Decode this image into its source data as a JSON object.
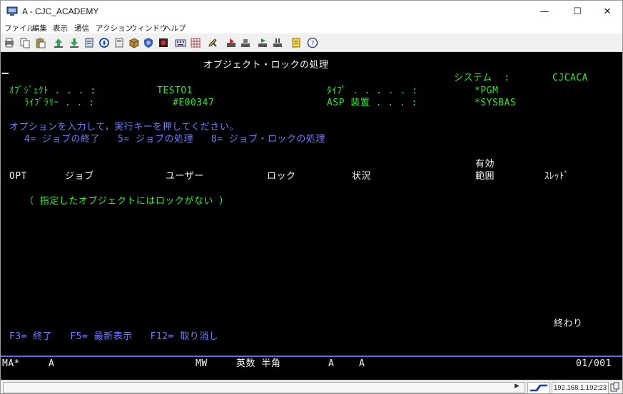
{
  "window": {
    "title": "A - CJC_ACADEMY",
    "controls": {
      "minimize": "—",
      "maximize": "☐",
      "close": "✕"
    }
  },
  "menu": [
    "ファイル",
    "編集",
    "表示",
    "通信",
    "アクション",
    "ウィンドウ",
    "ヘルプ"
  ],
  "toolbar_icons": [
    "print-screen-icon",
    "copy-icon",
    "paste-icon",
    "send-file-icon",
    "receive-file-icon",
    "macro-icon",
    "navigator-icon",
    "display-icon",
    "package-icon",
    "shield-icon",
    "record-icon",
    "keyboard-icon",
    "calculator-icon",
    "edit-icon",
    "play-macro-icon",
    "stop-icon",
    "run-icon",
    "pause-icon",
    "notes-icon",
    "help-icon"
  ],
  "screen": {
    "title": "オブジェクト・ロックの処理",
    "system_label": "システム  :",
    "system_value": "CJCACA",
    "object_label": "ｵﾌﾞｼﾞｪｸﾄ . . . :",
    "object_value": "TESTO1",
    "type_label": "ﾀｲﾌﾟ . . . . . :",
    "type_value": "*PGM",
    "library_label": "ﾗｲﾌﾞﾗﾘｰ . . :",
    "library_value": "#E00347",
    "asp_label": "ASP 装置 . . . :",
    "asp_value": "*SYSBAS",
    "instruction": "オプションを入力して，実行キーを押してください。",
    "options": "4= ジョブの終了   5= ジョブの処理   8= ジョブ・ロックの処理",
    "columns": {
      "opt": "OPT",
      "job": "ジョブ",
      "user": "ユーザー",
      "lock": "ロック",
      "status": "状況",
      "scope_line1": "有効",
      "scope_line2": "範囲",
      "thread": "ｽﾚｯﾄﾞ"
    },
    "empty_message": "（ 指定したオブジェクトにはロックがない ）",
    "end_label": "終わり",
    "fkeys": "F3= 終了   F5= 最新表示   F12= 取り消し"
  },
  "oia": {
    "ma": "MA*",
    "session": "A",
    "mw": "MW",
    "input_mode": "英数 半角",
    "a1": "A",
    "a2": "A",
    "cursor_pos": "01/001"
  },
  "statusbar": {
    "ip": "192.168.1.192:23"
  }
}
